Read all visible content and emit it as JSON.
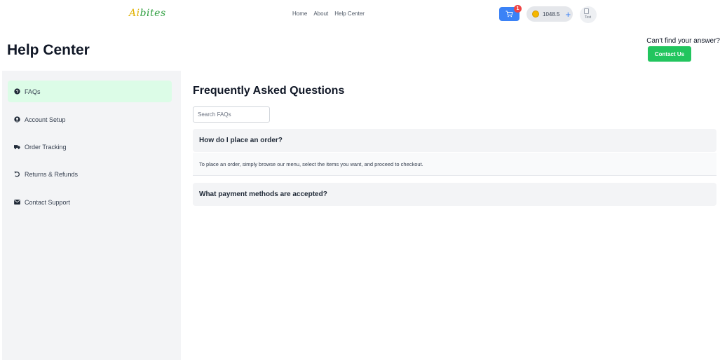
{
  "brand": {
    "logo_part1": "Ai",
    "logo_part2": "bites"
  },
  "nav": {
    "links": [
      "Home",
      "About",
      "Help Center"
    ]
  },
  "cart": {
    "badge_count": "1"
  },
  "wallet": {
    "balance": "1048.5"
  },
  "avatar": {
    "alt_text": "Test"
  },
  "header": {
    "title": "Help Center",
    "cant_find_text": "Can't find your answer?",
    "contact_button": "Contact Us"
  },
  "sidebar": {
    "items": [
      {
        "label": "FAQs",
        "icon": "question-circle-icon",
        "active": true
      },
      {
        "label": "Account Setup",
        "icon": "user-circle-icon",
        "active": false
      },
      {
        "label": "Order Tracking",
        "icon": "truck-icon",
        "active": false
      },
      {
        "label": "Returns & Refunds",
        "icon": "undo-icon",
        "active": false
      },
      {
        "label": "Contact Support",
        "icon": "envelope-icon",
        "active": false
      }
    ]
  },
  "main": {
    "title": "Frequently Asked Questions",
    "search_placeholder": "Search FAQs",
    "faqs": [
      {
        "question": "How do I place an order?",
        "answer": "To place an order, simply browse our menu, select the items you want, and proceed to checkout.",
        "expanded": true
      },
      {
        "question": "What payment methods are accepted?",
        "expanded": false
      }
    ]
  },
  "colors": {
    "primary_blue": "#3b82f6",
    "accent_green": "#22c55e",
    "active_item_bg": "#dcfce7",
    "badge_red": "#ef4444",
    "sidebar_bg": "#f3f4f6"
  }
}
